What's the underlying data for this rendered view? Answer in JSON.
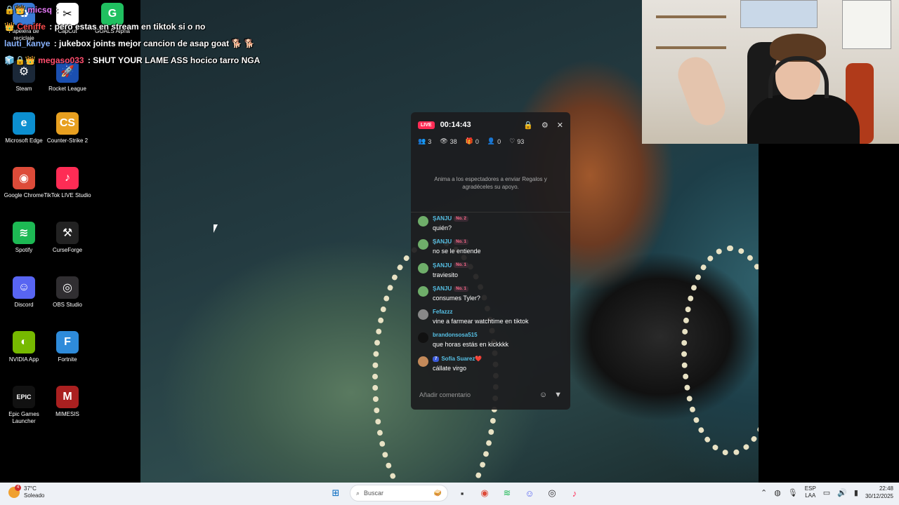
{
  "desktop": {
    "icons": [
      {
        "label": "Papelera de reciclaje",
        "color": "#3a7bd5",
        "glyph": "♻",
        "icon": "recycle-bin-icon"
      },
      {
        "label": "CapCut",
        "color": "#ffffff",
        "glyph": "✂",
        "icon": "capcut-icon"
      },
      {
        "label": "GOALS Alpha",
        "color": "#20c060",
        "glyph": "G",
        "icon": "goals-icon"
      },
      {
        "label": "Steam",
        "color": "#1b2838",
        "glyph": "⚙",
        "icon": "steam-icon"
      },
      {
        "label": "Rocket League",
        "color": "#1a4fb0",
        "glyph": "🚀",
        "icon": "rocket-league-icon"
      },
      {
        "label": "Microsoft Edge",
        "color": "#0c8fd0",
        "glyph": "e",
        "icon": "edge-icon"
      },
      {
        "label": "Counter-Strike 2",
        "color": "#e8a020",
        "glyph": "CS",
        "icon": "cs2-icon"
      },
      {
        "label": "Google Chrome",
        "color": "#dd4b39",
        "glyph": "◉",
        "icon": "chrome-icon"
      },
      {
        "label": "TikTok LIVE Studio",
        "color": "#fe2c55",
        "glyph": "♪",
        "icon": "tiktok-live-icon"
      },
      {
        "label": "Spotify",
        "color": "#1db954",
        "glyph": "≋",
        "icon": "spotify-icon"
      },
      {
        "label": "CurseForge",
        "color": "#222222",
        "glyph": "⚒",
        "icon": "curseforge-icon"
      },
      {
        "label": "Discord",
        "color": "#5865f2",
        "glyph": "☺",
        "icon": "discord-icon"
      },
      {
        "label": "OBS Studio",
        "color": "#302e31",
        "glyph": "◎",
        "icon": "obs-icon"
      },
      {
        "label": "NVIDIA App",
        "color": "#76b900",
        "glyph": "◐",
        "icon": "nvidia-icon"
      },
      {
        "label": "Fortnite",
        "color": "#2e8bda",
        "glyph": "F",
        "icon": "fortnite-icon"
      },
      {
        "label": "Epic Games Launcher",
        "color": "#111111",
        "glyph": "EPIC",
        "icon": "epic-games-icon"
      },
      {
        "label": "MIMESIS",
        "color": "#aa2020",
        "glyph": "M",
        "icon": "mimesis-icon"
      }
    ]
  },
  "overlay_chat": [
    {
      "user": "micsq",
      "user_color": "#e879f9",
      "text": ":"
    },
    {
      "user": "Ceniffe",
      "user_color": "#ff4d4d",
      "text": ": pero estas en stream en tiktok si o no"
    },
    {
      "user": "lauti_kanye",
      "user_color": "#8ab4ff",
      "text": ": jukebox joints mejor cancion de asap goat 🐕 🐕"
    },
    {
      "user": "megaso033",
      "user_color": "#ff4d6d",
      "text": ": SHUT YOUR LAME ASS hocico tarro NGA"
    }
  ],
  "live_panel": {
    "badge": "LIVE",
    "timer": "00:14:43",
    "stats": {
      "viewers_now": "3",
      "views": "38",
      "gifts": "0",
      "new_followers": "0",
      "likes": "93"
    },
    "gift_hint": "Anima a los espectadores a enviar Regalos y agradéceles su apoyo.",
    "comments": [
      {
        "user": "ŞANJU",
        "rank": "No. 2",
        "level": "",
        "text": "quién?",
        "avatar_color": "#6fae6a"
      },
      {
        "user": "ŞANJU",
        "rank": "No. 1",
        "level": "",
        "text": "no se le entiende",
        "avatar_color": "#6fae6a"
      },
      {
        "user": "ŞANJU",
        "rank": "No. 1",
        "level": "",
        "text": "traviesito",
        "avatar_color": "#6fae6a"
      },
      {
        "user": "ŞANJU",
        "rank": "No. 1",
        "level": "",
        "text": "consumes Tyler?",
        "avatar_color": "#6fae6a"
      },
      {
        "user": "Fefazzz",
        "rank": "",
        "level": "",
        "text": "vine a farmear watchtime en tiktok",
        "avatar_color": "#888888"
      },
      {
        "user": "brandonsosa515",
        "rank": "",
        "level": "",
        "text": "que horas estás en kickkkk",
        "avatar_color": "#111111"
      },
      {
        "user": "Sofía Suarez❤️",
        "rank": "",
        "level": "7",
        "text": "cállate virgo",
        "avatar_color": "#c48a5a"
      }
    ],
    "comment_placeholder": "Añadir comentario"
  },
  "taskbar": {
    "weather_temp": "37°C",
    "weather_desc": "Soleado",
    "weather_badge": "4",
    "search_placeholder": "Buscar",
    "lang_top": "ESP",
    "lang_bottom": "LAA",
    "time": "22:48",
    "date": "30/12/2025"
  }
}
